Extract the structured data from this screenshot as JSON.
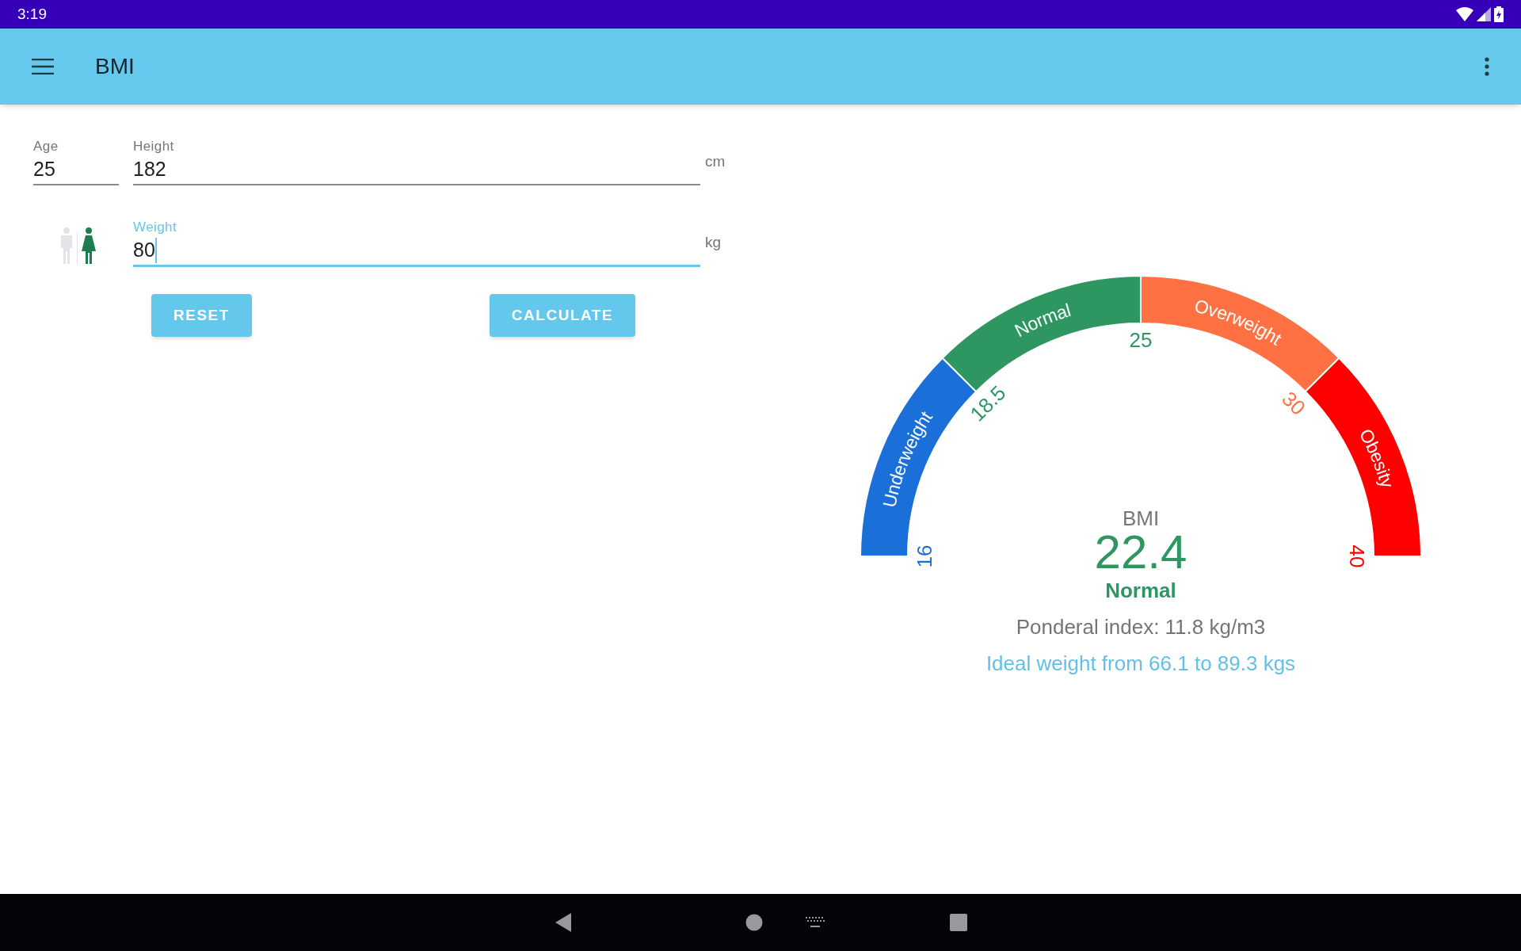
{
  "status_bar": {
    "time": "3:19"
  },
  "app_bar": {
    "title": "BMI"
  },
  "form": {
    "fields": [
      {
        "label": "Age",
        "value": "25",
        "focused": false
      },
      {
        "label": "Height",
        "value": "182",
        "unit": "cm",
        "focused": false
      },
      {
        "label": "Weight",
        "value": "80",
        "unit": "kg",
        "focused": true
      }
    ],
    "genders": [
      {
        "kind": "male",
        "selected": false
      },
      {
        "kind": "female",
        "selected": true
      }
    ],
    "buttons": [
      {
        "label": "RESET"
      },
      {
        "label": "CALCULATE"
      }
    ]
  },
  "gauge": {
    "segments": [
      {
        "label": "Underweight",
        "color": "#1a6fd8"
      },
      {
        "label": "Normal",
        "color": "#2e9660"
      },
      {
        "label": "Overweight",
        "color": "#ff7043"
      },
      {
        "label": "Obesity",
        "color": "#ff0000"
      }
    ],
    "ticks": [
      {
        "label": "16",
        "color": "#1a6fd8"
      },
      {
        "label": "18.5",
        "color": "#2e9660"
      },
      {
        "label": "25",
        "color": "#2e9660"
      },
      {
        "label": "30",
        "color": "#ff7043"
      },
      {
        "label": "40",
        "color": "#ff0000"
      }
    ]
  },
  "result": {
    "caption": "BMI",
    "value": "22.4",
    "category": "Normal",
    "ponderal": "Ponderal index: 11.8 kg/m3",
    "ideal": "Ideal weight from 66.1 to 89.3 kgs"
  }
}
